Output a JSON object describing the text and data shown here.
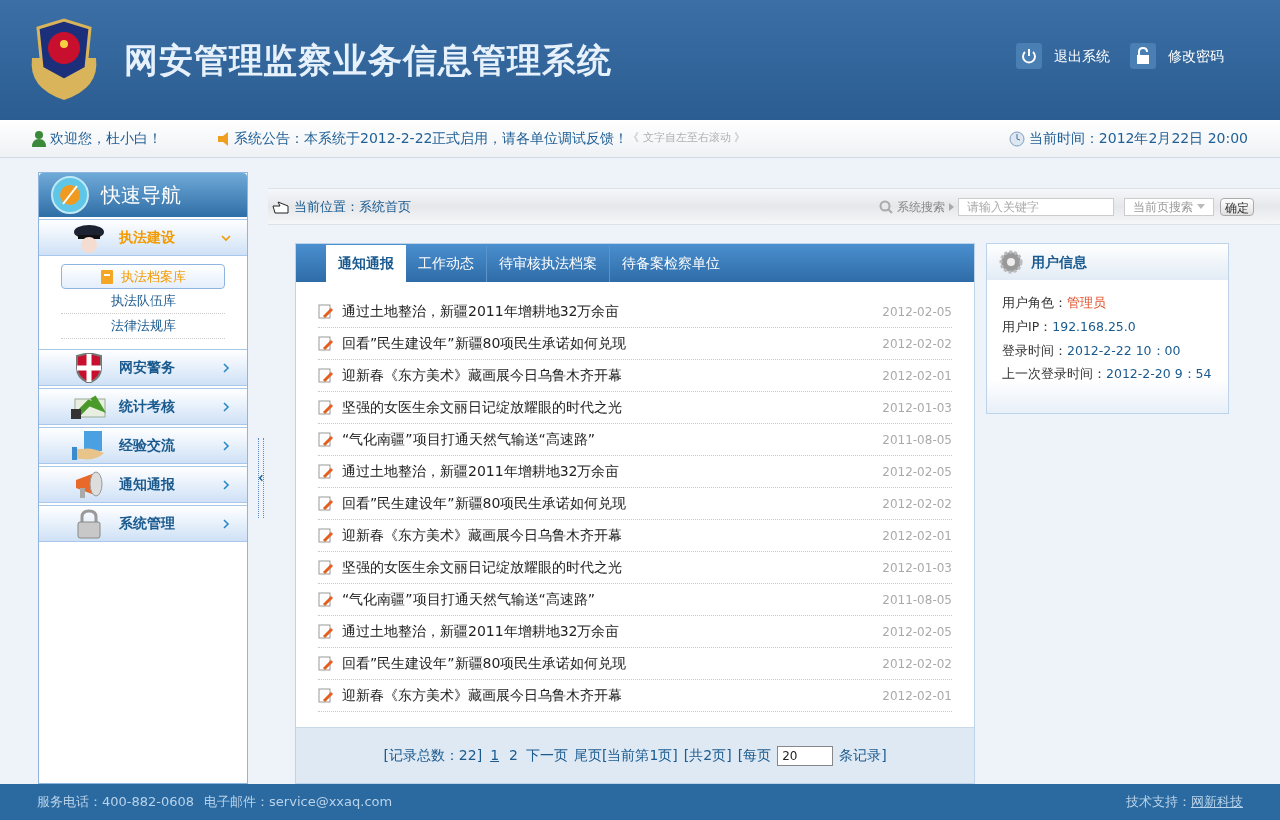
{
  "header": {
    "title": "网安管理监察业务信息管理系统",
    "actions": [
      {
        "kind": "power",
        "label": "退出系统"
      },
      {
        "kind": "lock",
        "label": "修改密码"
      }
    ]
  },
  "info_bar": {
    "welcome": "欢迎您，杜小白！",
    "notice": "系统公告：本系统于2012-2-22正式启用，请各单位调试反馈！",
    "notice_hint": "《 文字自左至右滚动 》",
    "time": "当前时间：2012年2月22日 20:00"
  },
  "sidebar": {
    "title": "快速导航",
    "items": [
      {
        "kind": "officer",
        "label": "执法建设",
        "expanded": true,
        "children": [
          {
            "label": "执法档案库",
            "selected": true
          },
          {
            "label": "执法队伍库",
            "selected": false
          },
          {
            "label": "法律法规库",
            "selected": false
          }
        ]
      },
      {
        "kind": "shield",
        "label": "网安警务",
        "expanded": false
      },
      {
        "kind": "chart",
        "label": "统计考核",
        "expanded": false
      },
      {
        "kind": "hand",
        "label": "经验交流",
        "expanded": false
      },
      {
        "kind": "megaphone",
        "label": "通知通报",
        "expanded": false
      },
      {
        "kind": "padlock",
        "label": "系统管理",
        "expanded": false
      }
    ]
  },
  "breadcrumb": {
    "label": "当前位置：",
    "page": "系统首页"
  },
  "search": {
    "label": "系统搜索",
    "placeholder": "请输入关键字",
    "scope": "当前页搜索",
    "button": "确定"
  },
  "tabs": [
    {
      "label": "通知通报",
      "selected": true
    },
    {
      "label": "工作动态",
      "selected": false
    },
    {
      "label": "待审核执法档案",
      "selected": false
    },
    {
      "label": "待备案检察单位",
      "selected": false
    }
  ],
  "news": [
    {
      "title": "通过土地整治，新疆2011年增耕地32万余亩",
      "date": "2012-02-05"
    },
    {
      "title": "回看”民生建设年”新疆80项民生承诺如何兑现",
      "date": "2012-02-02"
    },
    {
      "title": "迎新春《东方美术》藏画展今日乌鲁木齐开幕",
      "date": "2012-02-01"
    },
    {
      "title": "坚强的女医生余文丽日记绽放耀眼的时代之光",
      "date": "2012-01-03"
    },
    {
      "title": "“气化南疆”项目打通天然气输送“高速路”",
      "date": "2011-08-05"
    },
    {
      "title": "通过土地整治，新疆2011年增耕地32万余亩",
      "date": "2012-02-05"
    },
    {
      "title": "回看”民生建设年”新疆80项民生承诺如何兑现",
      "date": "2012-02-02"
    },
    {
      "title": "迎新春《东方美术》藏画展今日乌鲁木齐开幕",
      "date": "2012-02-01"
    },
    {
      "title": "坚强的女医生余文丽日记绽放耀眼的时代之光",
      "date": "2012-01-03"
    },
    {
      "title": "“气化南疆”项目打通天然气输送“高速路”",
      "date": "2011-08-05"
    },
    {
      "title": "通过土地整治，新疆2011年增耕地32万余亩",
      "date": "2012-02-05"
    },
    {
      "title": "回看”民生建设年”新疆80项民生承诺如何兑现",
      "date": "2012-02-02"
    },
    {
      "title": "迎新春《东方美术》藏画展今日乌鲁木齐开幕",
      "date": "2012-02-01"
    }
  ],
  "pagination": {
    "total": "[记录总数：22]",
    "pages": [
      {
        "label": "1",
        "selected": true
      },
      {
        "label": "2",
        "selected": false
      }
    ],
    "next": "下一页",
    "last": "尾页[当前第1页]",
    "count": "[共2页]",
    "per_page_label": "[每页",
    "per_page": "20",
    "suffix": "条记录]"
  },
  "user_info": {
    "title": "用户信息",
    "rows": [
      {
        "label": "用户角色：",
        "value": "管理员",
        "kind": "role"
      },
      {
        "label": "用户IP：",
        "value": "192.168.25.0",
        "kind": "plain"
      },
      {
        "label": "登录时间：",
        "value": "2012-2-22 10：00",
        "kind": "plain"
      },
      {
        "label": "上一次登录时间：",
        "value": "2012-2-20 9：54",
        "kind": "plain"
      }
    ]
  },
  "footer": {
    "phone": "服务电话：400-882-0608",
    "email": "电子邮件：service@xxaq.com",
    "support_label": "技术支持：",
    "support": "网新科技"
  }
}
